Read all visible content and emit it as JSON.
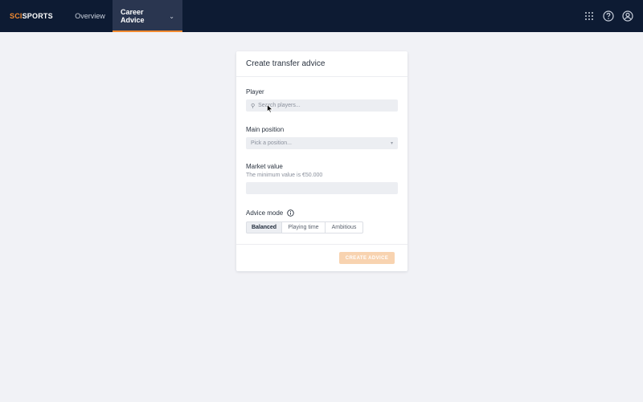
{
  "brand": {
    "logo_prefix": "SCI",
    "logo_suffix": "SPORTS",
    "accent_color": "#f28a30",
    "navbar_color": "#0d1b33"
  },
  "nav": {
    "items": [
      {
        "label": "Overview"
      },
      {
        "label": "Career Advice"
      }
    ],
    "active": "Career Advice",
    "right_icons": [
      "apps-grid-icon",
      "help-icon",
      "account-icon"
    ]
  },
  "card": {
    "title": "Create transfer advice",
    "player": {
      "label": "Player",
      "placeholder": "Search players..."
    },
    "position": {
      "label": "Main position",
      "placeholder": "Pick a position..."
    },
    "market_value": {
      "label": "Market value",
      "help": "The minimum value is €50.000",
      "value": ""
    },
    "advice_mode": {
      "label": "Advice mode",
      "options": [
        "Balanced",
        "Playing time",
        "Ambitious"
      ],
      "selected": "Balanced"
    },
    "submit_label": "CREATE ADVICE"
  }
}
